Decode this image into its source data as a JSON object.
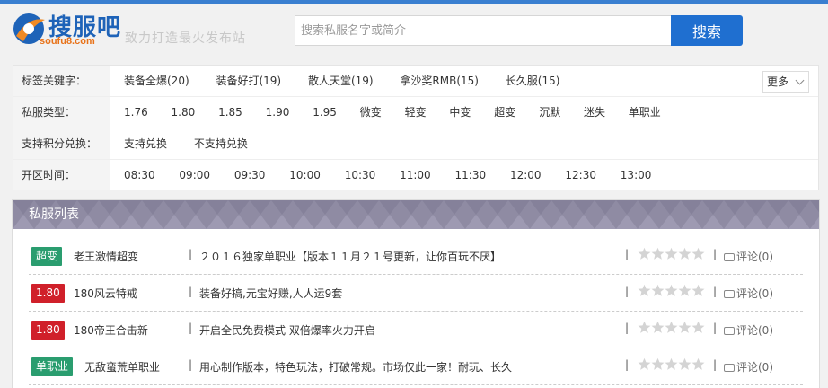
{
  "header": {
    "logo_title": "搜服吧",
    "logo_domain": "soufu8.com",
    "slogan": "致力打造最火发布站",
    "search_placeholder": "搜索私服名字或简介",
    "search_button": "搜索",
    "accent_color": "#1f6fd0"
  },
  "filters": {
    "rows": [
      {
        "label": "标签关键字：",
        "items": [
          "装备全爆(20)",
          "装备好打(19)",
          "散人天堂(19)",
          "拿沙奖RMB(15)",
          "长久服(15)"
        ]
      },
      {
        "label": "私服类型：",
        "items": [
          "1.76",
          "1.80",
          "1.85",
          "1.90",
          "1.95",
          "微变",
          "轻变",
          "中变",
          "超变",
          "沉默",
          "迷失",
          "单职业"
        ]
      },
      {
        "label": "支持积分兑换：",
        "items": [
          "支持兑换",
          "不支持兑换"
        ]
      },
      {
        "label": "开区时间：",
        "items": [
          "08:30",
          "09:00",
          "09:30",
          "10:00",
          "10:30",
          "11:00",
          "11:30",
          "12:00",
          "12:30",
          "13:00"
        ]
      }
    ],
    "more_label": "更多"
  },
  "list": {
    "title": "私服列表",
    "header_color": "#8f8ba3",
    "rows": [
      {
        "badge": "超变",
        "badge_color": "#2a9d6f",
        "name": "老王激情超变",
        "desc": "２０１６独家单职业【版本１１月２１号更新，让你百玩不厌】",
        "rating": 0,
        "comment": "评论(0)"
      },
      {
        "badge": "1.80",
        "badge_color": "#d0202a",
        "name": "180风云特戒",
        "desc": "装备好搞,元宝好赚,人人运9套",
        "rating": 0,
        "comment": "评论(0)"
      },
      {
        "badge": "1.80",
        "badge_color": "#d0202a",
        "name": "180帝王合击新",
        "desc": "开启全民免费模式 双倍爆率火力开启",
        "rating": 0,
        "comment": "评论(0)"
      },
      {
        "badge": "单职业",
        "badge_color": "#2a9d6f",
        "name": "无敌蛮荒单职业",
        "desc": "用心制作版本，特色玩法，打破常规。市场仅此一家！耐玩、长久",
        "rating": 0,
        "comment": "评论(0)"
      }
    ]
  }
}
